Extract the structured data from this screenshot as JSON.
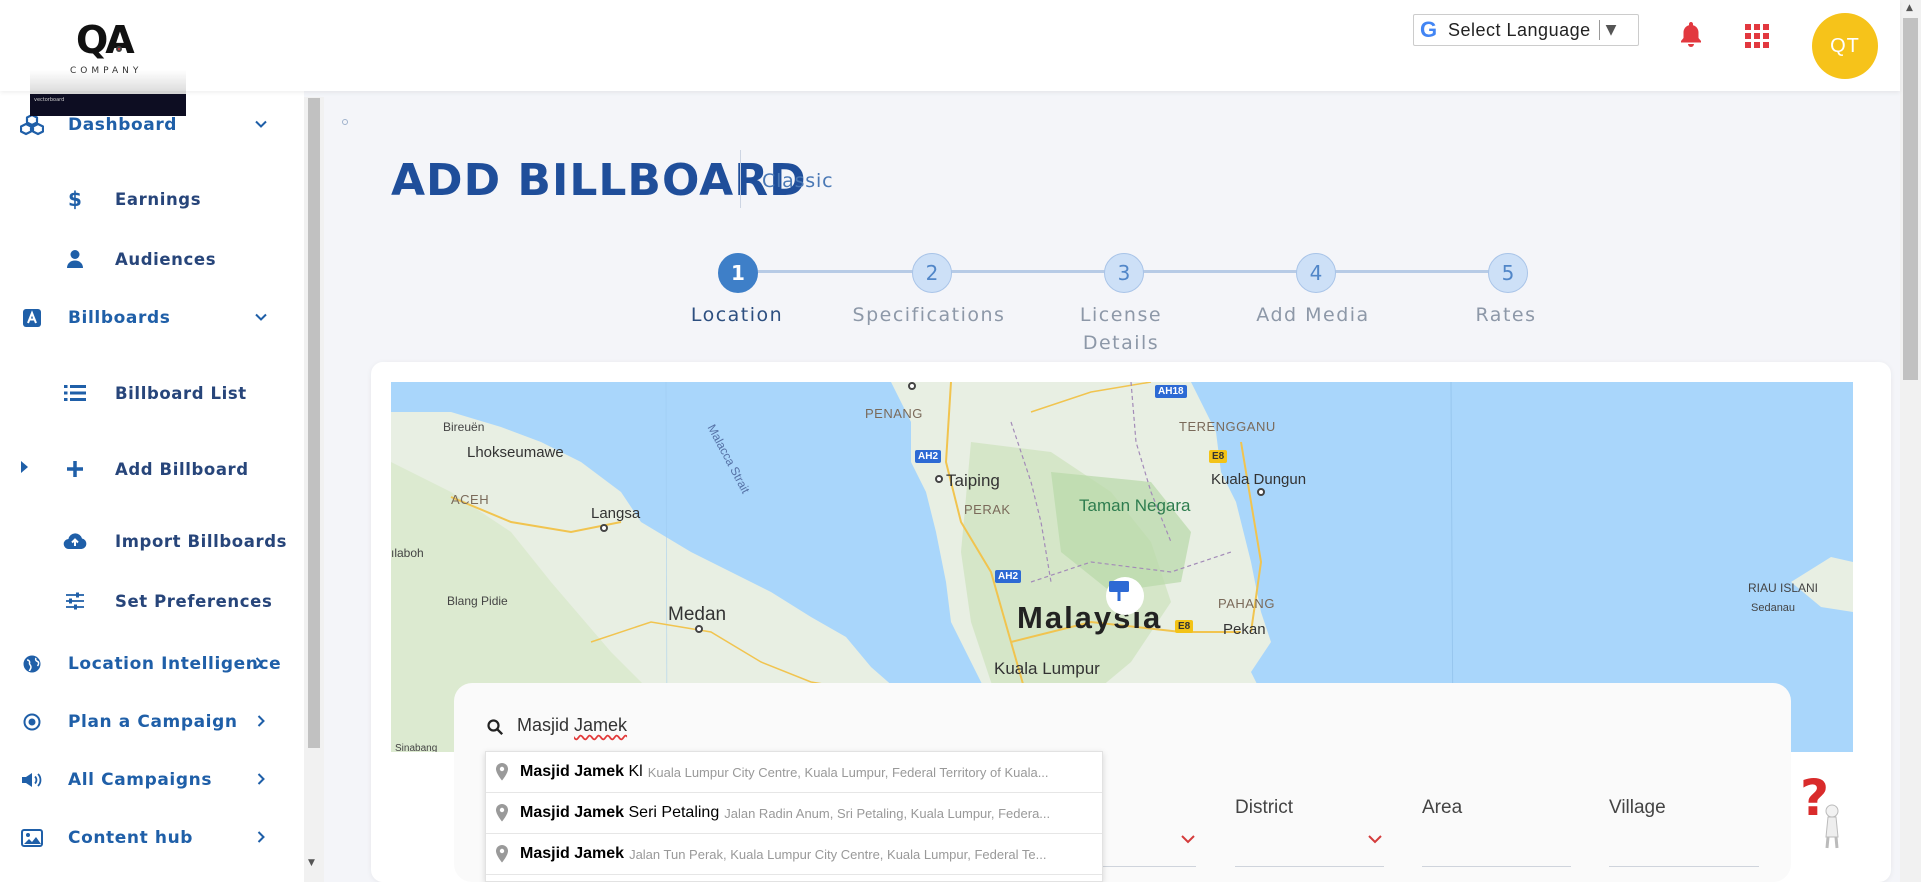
{
  "header": {
    "logo": {
      "mark": "QA",
      "company": "COMPANY",
      "strip_text": "vectorboard"
    },
    "language": {
      "g": "G",
      "label": "Select Language",
      "arrow": "▼"
    },
    "avatar_initials": "QT",
    "colors": {
      "bell": "#e2383f",
      "apps": "#e2383f",
      "avatar": "#f6c31a"
    }
  },
  "sidebar": {
    "items": [
      {
        "label": "Dashboard",
        "icon": "cubes-icon"
      },
      {
        "label": "Earnings",
        "icon": "dollar-icon"
      },
      {
        "label": "Audiences",
        "icon": "user-icon"
      },
      {
        "label": "Billboards",
        "icon": "billboard-a-icon"
      },
      {
        "label": "Billboard List",
        "icon": "list-icon"
      },
      {
        "label": "Add Billboard",
        "icon": "plus-icon"
      },
      {
        "label": "Import Billboards",
        "icon": "cloud-upload-icon"
      },
      {
        "label": "Set Preferences",
        "icon": "sliders-icon"
      },
      {
        "label": "Location Intelligence",
        "icon": "globe-icon"
      },
      {
        "label": "Plan a Campaign",
        "icon": "target-icon"
      },
      {
        "label": "All Campaigns",
        "icon": "megaphone-icon"
      },
      {
        "label": "Content hub",
        "icon": "image-icon"
      }
    ]
  },
  "page": {
    "title": "ADD BILLBOARD",
    "subtitle": "Classic"
  },
  "stepper": {
    "current": 1,
    "steps": [
      {
        "num": "1",
        "label": "Location"
      },
      {
        "num": "2",
        "label": "Specifications"
      },
      {
        "num": "3",
        "label": "License Details"
      },
      {
        "num": "4",
        "label": "Add Media"
      },
      {
        "num": "5",
        "label": "Rates"
      }
    ]
  },
  "map": {
    "labels": {
      "bireuen": "Bireuën",
      "lhokseumawe": "Lhokseumawe",
      "aceh": "ACEH",
      "langsa": "Langsa",
      "meulaboh": "ılaboh",
      "blang_pidie": "Blang Pidie",
      "medan": "Medan",
      "sinabang": "Sinabang",
      "penang": "PENANG",
      "taiping": "Taiping",
      "perak": "PERAK",
      "malacca_strait": "Malacca Strait",
      "terengganu": "TERENGGANU",
      "kuala_dungun": "Kuala Dungun",
      "taman_negara": "Taman Negara",
      "malaysia": "Malaysia",
      "pahang": "PAHANG",
      "pekan": "Pekan",
      "kuala_lumpur": "Kuala Lumpur",
      "riau": "RIAU ISLANI",
      "sedanau": "Sedanau"
    },
    "shields": {
      "ah18": "AH18",
      "ah2_north": "AH2",
      "ah2_south": "AH2",
      "e8_north": "E8",
      "e8_south": "E8"
    }
  },
  "search": {
    "value_bold": "Masjid",
    "value_rest": "Jamek",
    "suggestions": [
      {
        "main_bold": "Masjid Jamek",
        "main_rest": " Kl",
        "secondary": "Kuala Lumpur City Centre, Kuala Lumpur, Federal Territory of Kuala..."
      },
      {
        "main_bold": "Masjid Jamek",
        "main_rest": " Seri Petaling",
        "secondary": "Jalan Radin Anum, Sri Petaling, Kuala Lumpur, Federa..."
      },
      {
        "main_bold": "Masjid Jamek",
        "main_rest": "",
        "secondary": "Jalan Tun Perak, Kuala Lumpur City Centre, Kuala Lumpur, Federal Te..."
      }
    ]
  },
  "fields": {
    "district": "District",
    "area": "Area",
    "village": "Village"
  }
}
